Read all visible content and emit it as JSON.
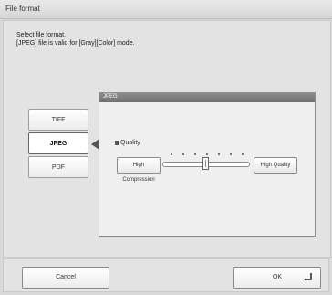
{
  "window": {
    "title": "File format"
  },
  "instructions": {
    "line1": "Select file format.",
    "line2": "[JPEG] file is valid for [Gray][Color] mode."
  },
  "formats": [
    {
      "label": "TIFF",
      "selected": false
    },
    {
      "label": "JPEG",
      "selected": true
    },
    {
      "label": "PDF",
      "selected": false
    }
  ],
  "jpeg_panel": {
    "header": "JPEG",
    "quality_label": "Quality",
    "low_button": "High Compression",
    "high_button": "High Quality",
    "slider_steps": 7,
    "slider_value_step": 3
  },
  "footer": {
    "cancel_label": "Cancel",
    "ok_label": "OK"
  },
  "icons": {
    "selection_arrow": "triangle-left-icon",
    "quality_marker": "square-icon",
    "ok_enter": "enter-key-icon"
  },
  "colors": {
    "panel_header": "#7a7a7a",
    "background": "#d9d9d9"
  }
}
